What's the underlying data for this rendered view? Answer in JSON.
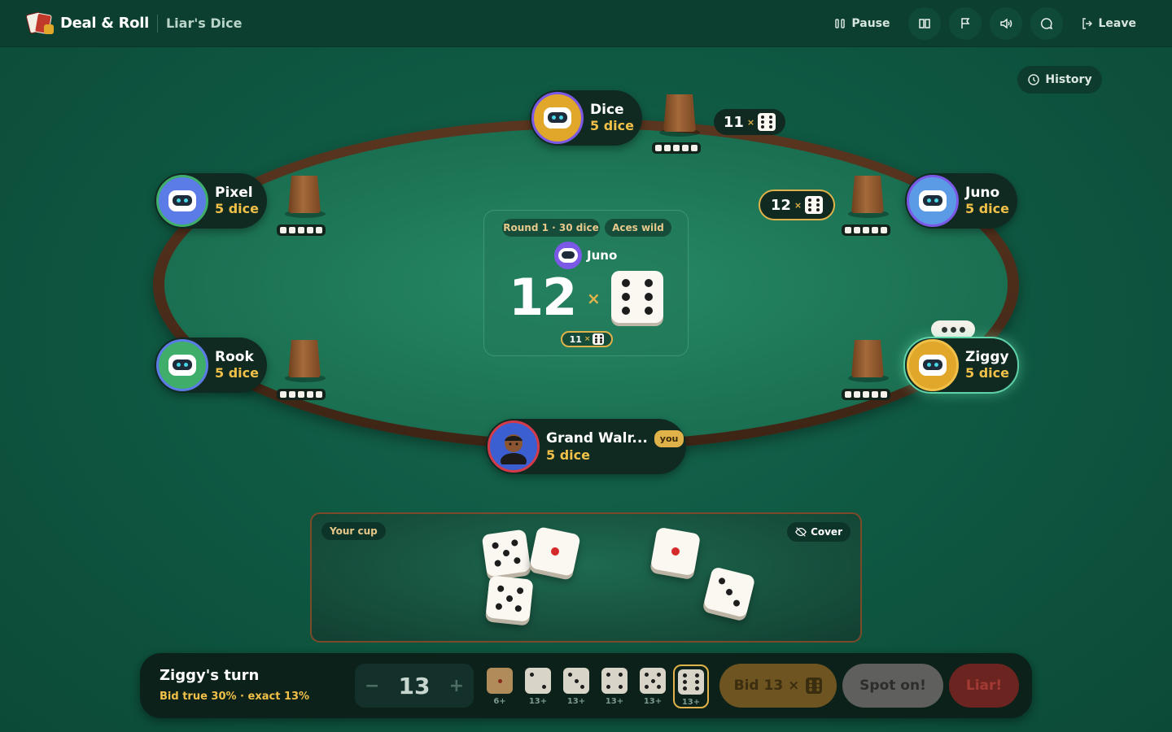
{
  "header": {
    "brand": "Deal & Roll",
    "game": "Liar's Dice",
    "pause_label": "Pause",
    "leave_label": "Leave",
    "icons": [
      "book-icon",
      "flag-icon",
      "volume-icon",
      "chat-icon"
    ]
  },
  "history_label": "History",
  "center": {
    "round_pill": "Round 1 · 30 dice",
    "rule_pill": "Aces wild",
    "current_bidder": "Juno",
    "bid_quantity": "12",
    "bid_face": 6,
    "times_symbol": "×",
    "previous_bid_quantity": "11",
    "previous_bid_face": 6
  },
  "players": [
    {
      "name": "Dice",
      "dice": "5 dice",
      "avatar_color": "#e0a72a"
    },
    {
      "name": "Pixel",
      "dice": "5 dice",
      "avatar_color": "#3fae6a"
    },
    {
      "name": "Juno",
      "dice": "5 dice",
      "avatar_color": "#7b59e6"
    },
    {
      "name": "Rook",
      "dice": "5 dice",
      "avatar_color": "#3fae6a"
    },
    {
      "name": "Ziggy",
      "dice": "5 dice",
      "avatar_color": "#e0a72a"
    },
    {
      "name": "Grand Walr...",
      "dice": "5 dice",
      "badge": "you",
      "avatar_color": "#d43b4a"
    }
  ],
  "bid_badges": {
    "dice_bid": "11",
    "juno_bid": "12",
    "symbol": "×"
  },
  "your_cup": {
    "label": "Your cup",
    "cover_label": "Cover",
    "dice": [
      5,
      1,
      5,
      1,
      3
    ]
  },
  "action_bar": {
    "turn_title": "Ziggy's turn",
    "turn_sub": "Bid true 30% · exact 13%",
    "stepper_minus": "−",
    "stepper_value": "13",
    "stepper_plus": "+",
    "face_options": [
      {
        "face": 1,
        "label": "6+"
      },
      {
        "face": 2,
        "label": "13+"
      },
      {
        "face": 3,
        "label": "13+"
      },
      {
        "face": 4,
        "label": "13+"
      },
      {
        "face": 5,
        "label": "13+"
      },
      {
        "face": 6,
        "label": "13+",
        "selected": true
      }
    ],
    "bid_button": "Bid 13 ×",
    "spot_on_button": "Spot on!",
    "liar_button": "Liar!"
  },
  "colors": {
    "accent_gold": "#e0b24a",
    "felt": "#1d7555",
    "header_bg": "#0c3f30"
  }
}
